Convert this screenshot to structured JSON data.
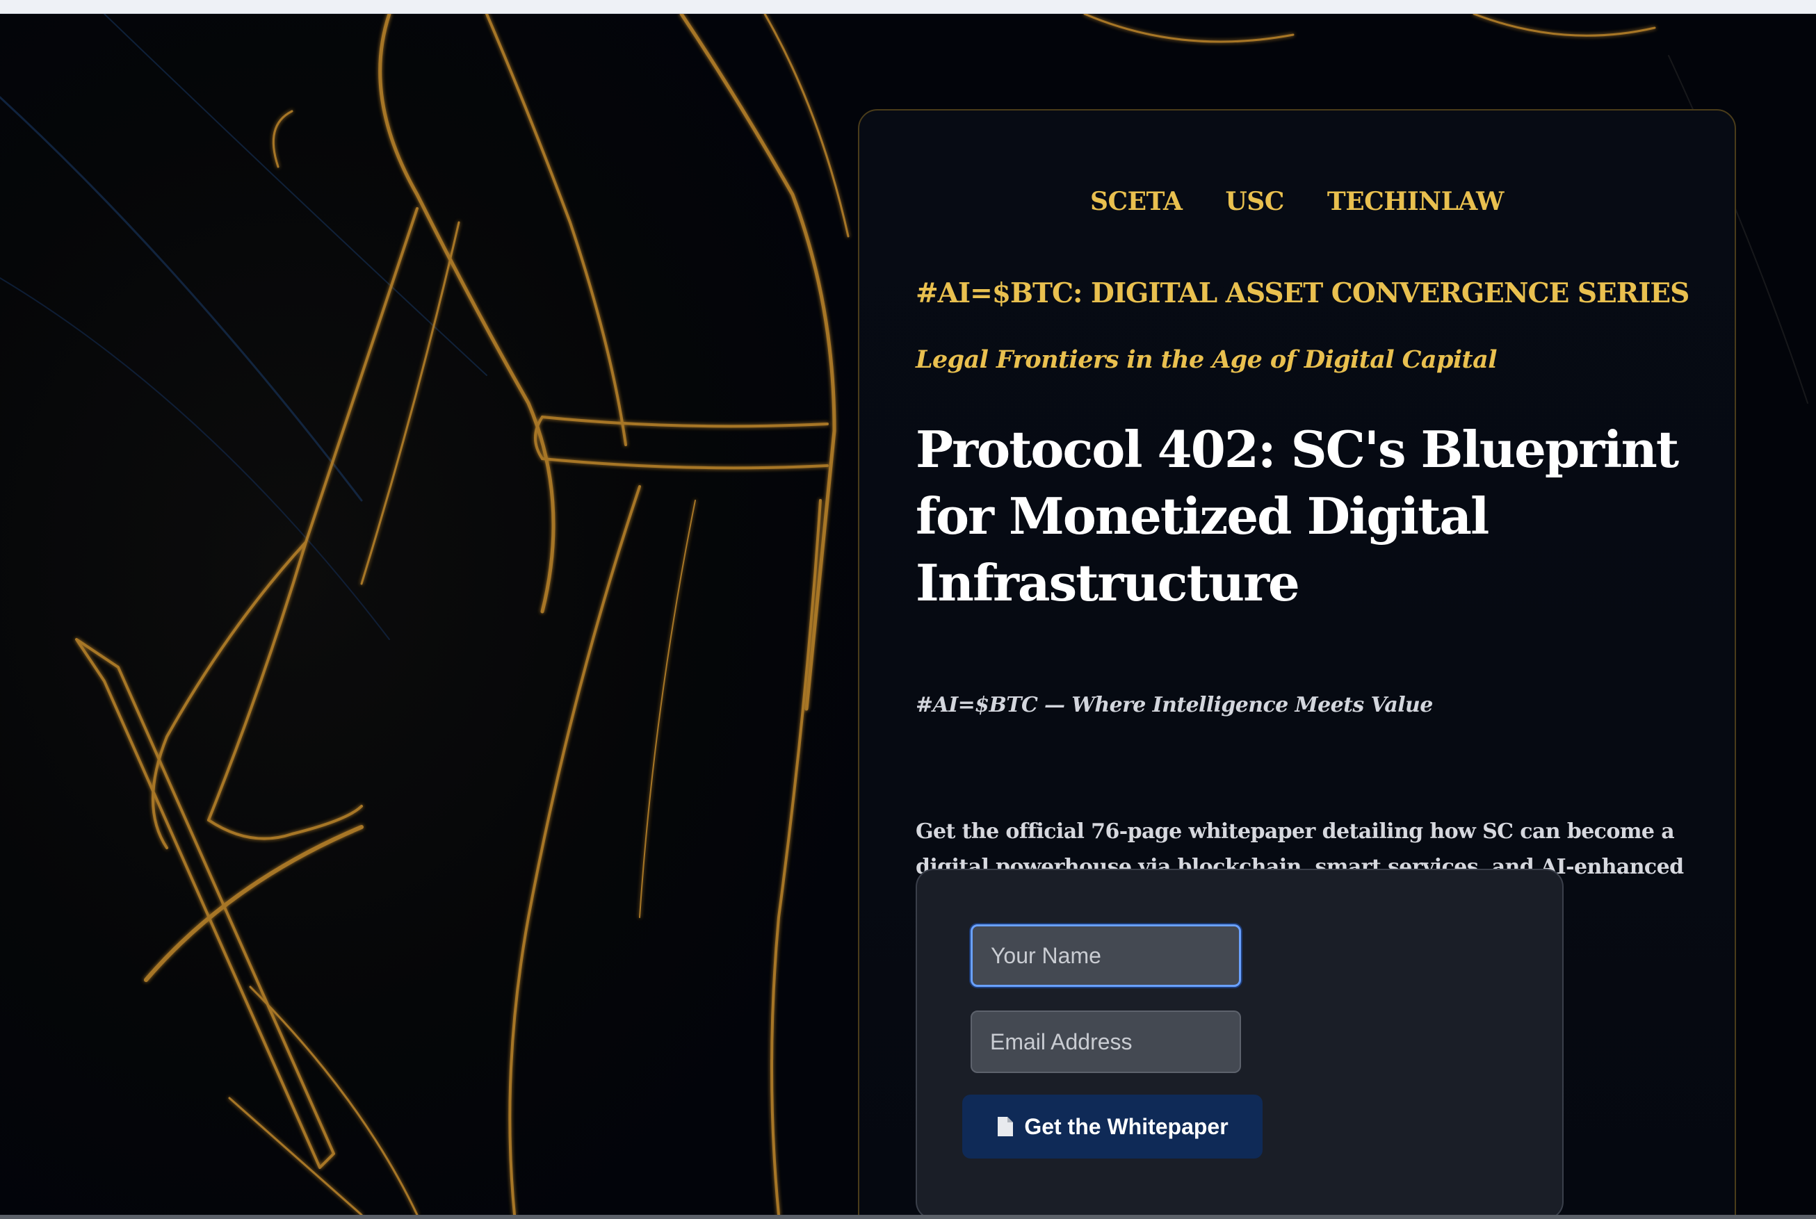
{
  "nav": {
    "links": [
      "SCETA",
      "USC",
      "TECHINLAW"
    ]
  },
  "hero": {
    "series_title": "#AI=$BTC: DIGITAL ASSET CONVERGENCE SERIES",
    "tagline": "Legal Frontiers in the Age of Digital Capital",
    "headline": "Protocol 402: SC's Blueprint for Monetized Digital Infrastructure",
    "motto": "#AI=$BTC — Where Intelligence Meets Value",
    "description": "Get the official 76-page whitepaper detailing how SC can become a digital powerhouse via blockchain, smart services, and AI-enhanced governance."
  },
  "form": {
    "name_placeholder": "Your Name",
    "name_value": "",
    "email_placeholder": "Email Address",
    "email_value": "",
    "submit_label": "Get the Whitepaper",
    "submit_icon": "document-icon"
  },
  "colors": {
    "accent_gold": "#e9c04f",
    "background": "#02060d",
    "button": "#0f2a57",
    "focus_ring": "#6aa1ff"
  }
}
